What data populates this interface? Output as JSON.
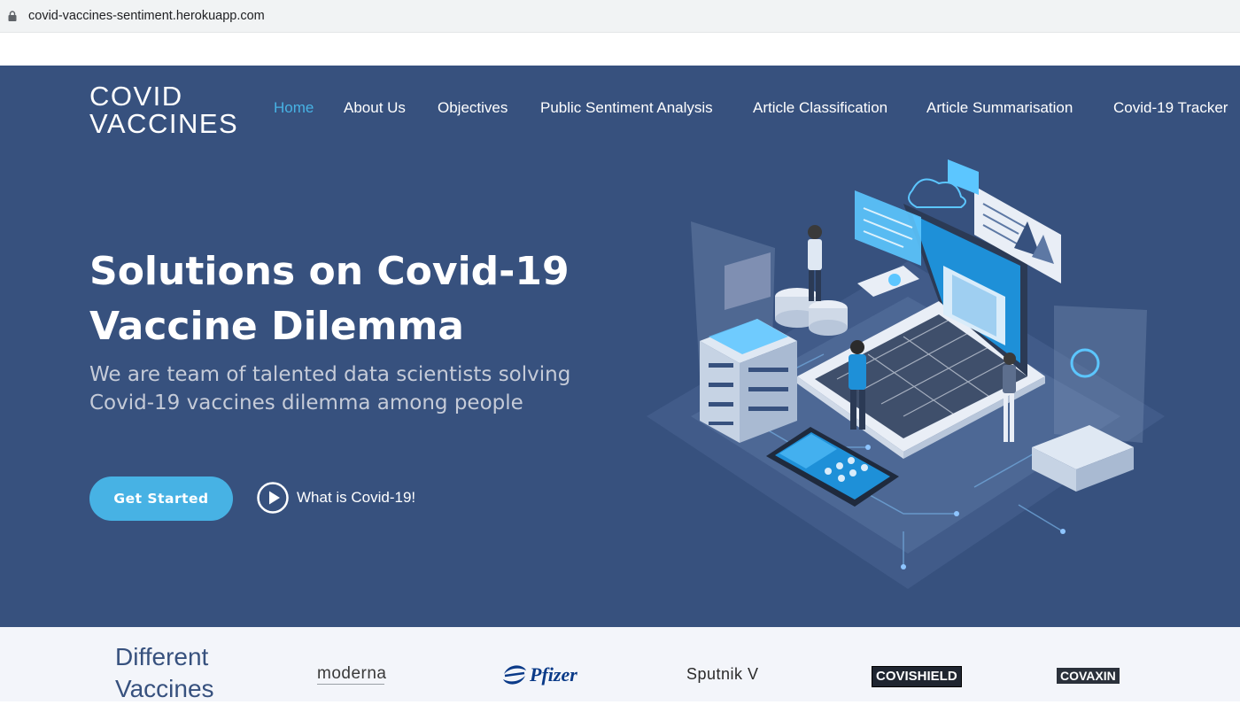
{
  "browser": {
    "url": "covid-vaccines-sentiment.herokuapp.com"
  },
  "header": {
    "logo": [
      "COVID",
      "VACCINES"
    ],
    "nav": [
      {
        "label": "Home",
        "active": true
      },
      {
        "label": "About Us"
      },
      {
        "label": "Objectives"
      },
      {
        "label": "Public Sentiment Analysis"
      },
      {
        "label": "Article Classification"
      },
      {
        "label": "Article Summarisation"
      },
      {
        "label": "Covid-19 Tracker"
      }
    ]
  },
  "hero": {
    "headline": [
      "Solutions on Covid-19",
      "Vaccine Dilemma"
    ],
    "subline": [
      "We are team of talented data scientists solving",
      "Covid-19 vaccines dilemma among people"
    ],
    "cta_label": "Get Started",
    "video_label": "What is Covid-19!",
    "illustration_icon": "isometric-laptop-data-illustration"
  },
  "vaccines": {
    "title": [
      "Different",
      "Vaccines"
    ],
    "logos": [
      "moderna",
      "Pfizer",
      "Sputnik V",
      "COVISHIELD",
      "COVAXIN"
    ]
  },
  "colors": {
    "hero_bg": "#37517e",
    "accent": "#47b2e4",
    "strip_bg": "#f3f5fa"
  }
}
